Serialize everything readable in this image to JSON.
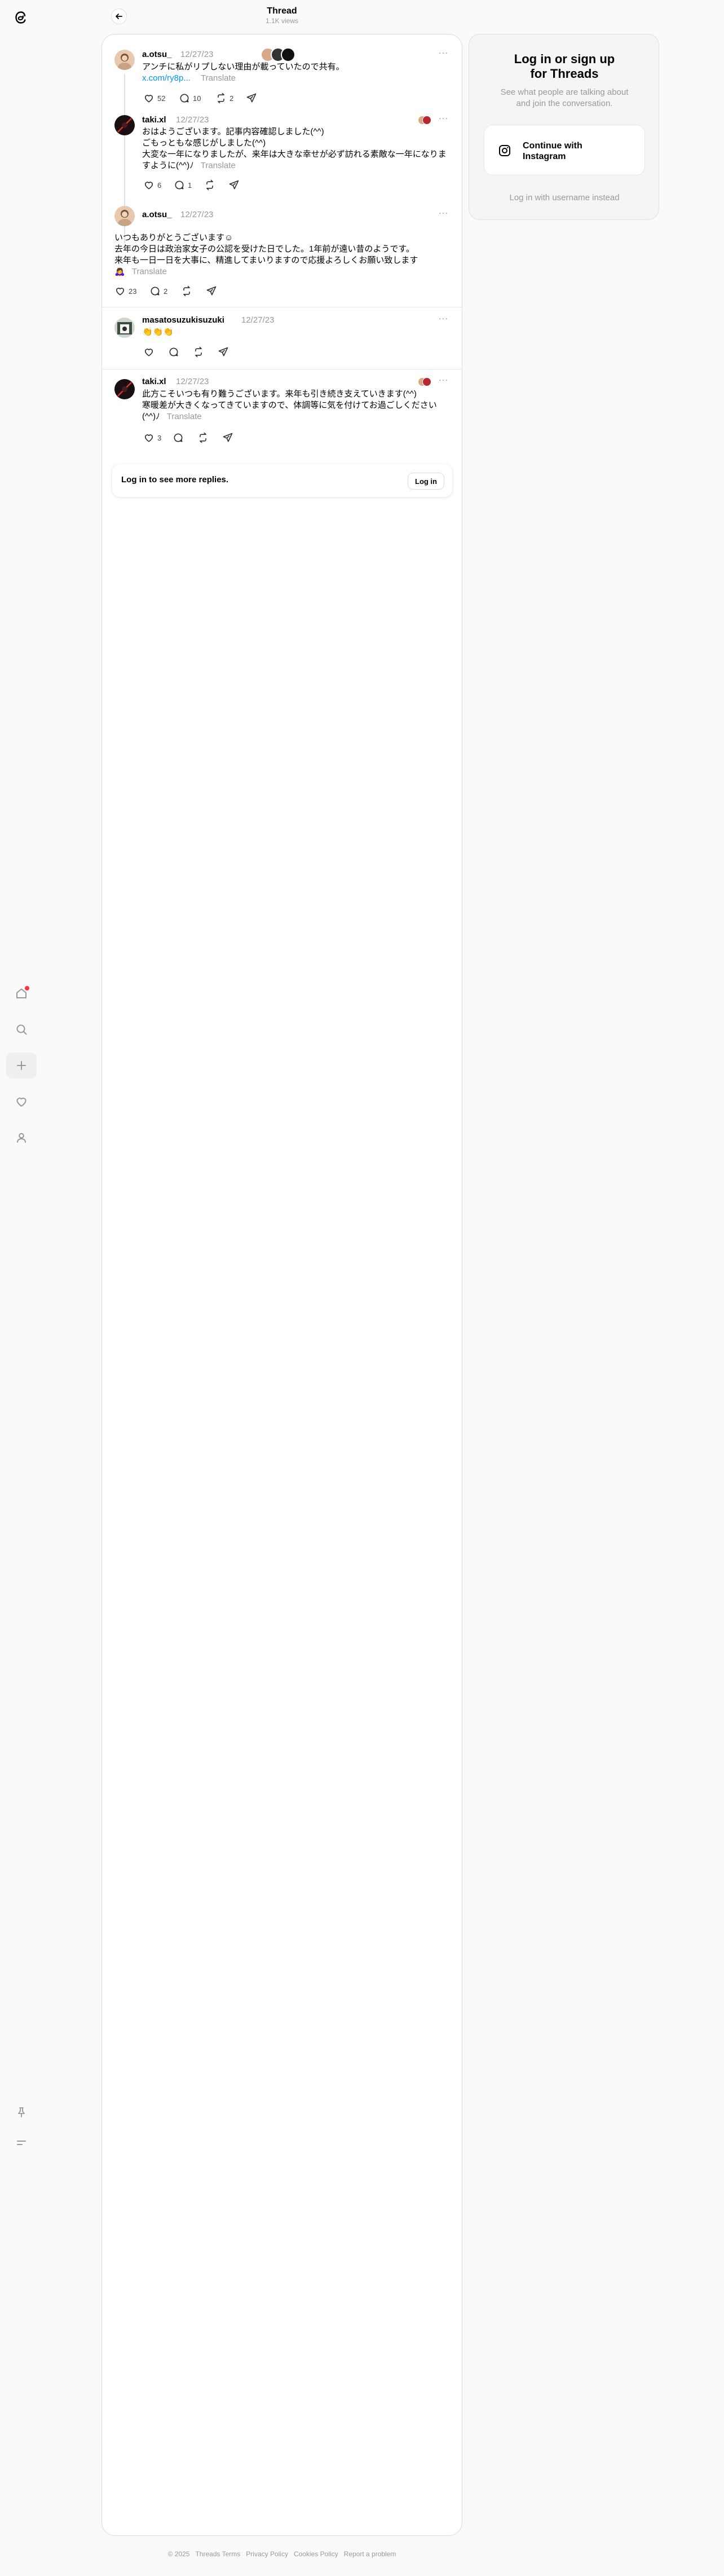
{
  "header": {
    "title": "Thread",
    "subtitle": "1.1K views"
  },
  "posts": [
    {
      "username": "a.otsu_",
      "date": "12/27/23",
      "line1": "アンチに私がリプしない理由が載っていたので共有。",
      "link": "x.com/ry8p...",
      "translate": "Translate",
      "likes": "52",
      "replies": "10",
      "reposts": "2"
    },
    {
      "username": "taki.xl",
      "date": "12/27/23",
      "lines": [
        "おはようございます。記事内容確認しました(^^)",
        "ごもっともな感じがしました(^^)",
        "大変な一年になりましたが、来年は大きな幸せが必ず訪れる素敵な一年になりま"
      ],
      "line_last": "すように(^^)ﾉ",
      "translate": "Translate",
      "likes": "6",
      "replies": "1"
    },
    {
      "username": "a.otsu_",
      "date": "12/27/23",
      "lines": [
        "いつもありがとうございます☺︎",
        "去年の今日は政治家女子の公認を受けた日でした。1年前が遠い昔のようです。",
        "来年も一日一日を大事に、精進してまいりますので応援よろしくお願い致します"
      ],
      "line_last": "🙇‍♀️",
      "translate": "Translate",
      "likes": "23",
      "replies": "2"
    },
    {
      "username": "masatosuzukisuzuki",
      "date": "12/27/23",
      "text": "👏👏👏"
    },
    {
      "username": "taki.xl",
      "date": "12/27/23",
      "lines": [
        "此方こそいつも有り難うございます。来年も引き続き支えていきます(^^)",
        "寒暖差が大きくなってきていますので、体調等に気を付けてお過ごしください"
      ],
      "line_last": "(^^)ﾉ",
      "translate": "Translate",
      "likes": "3"
    }
  ],
  "more_label": "···",
  "login_prompt": {
    "text": "Log in to see more replies.",
    "button": "Log in"
  },
  "right_panel": {
    "title_line1": "Log in or sign up",
    "title_line2": "for Threads",
    "subtitle_line1": "See what people are talking about",
    "subtitle_line2": "and join the conversation.",
    "instagram_line1": "Continue with",
    "instagram_line2": "Instagram",
    "alt_login": "Log in with username instead"
  },
  "footer": [
    "© 2025",
    "Threads Terms",
    "Privacy Policy",
    "Cookies Policy",
    "Report a problem"
  ],
  "icons": [
    "threads-logo-icon",
    "home-icon",
    "search-icon",
    "plus-icon",
    "heart-icon",
    "profile-icon",
    "pin-icon",
    "menu-icon",
    "back-arrow-icon",
    "comment-icon",
    "repost-icon",
    "share-icon",
    "instagram-icon"
  ],
  "colors": {
    "accent_link": "#0095f6",
    "notification_dot": "#ff3040",
    "muted": "#999999"
  }
}
